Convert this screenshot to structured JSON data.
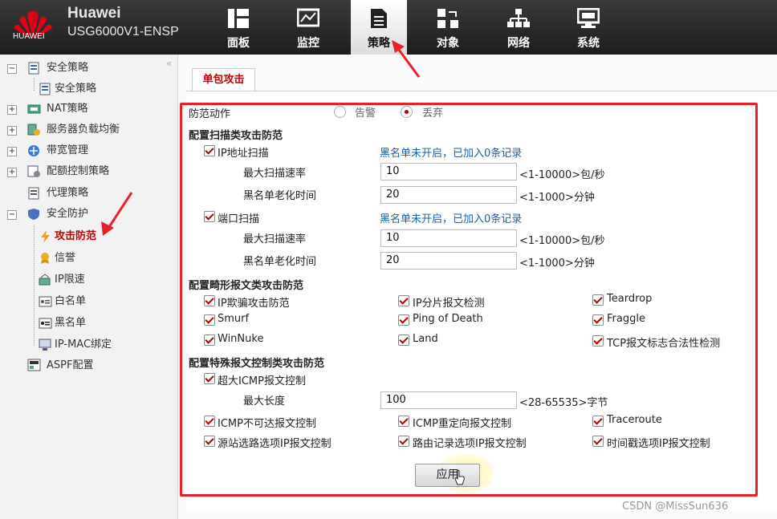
{
  "header": {
    "logo_text": "HUAWEI",
    "brand": "Huawei",
    "model": "USG6000V1-ENSP",
    "nav": [
      {
        "label": "面板",
        "icon": "dashboard-icon"
      },
      {
        "label": "监控",
        "icon": "monitor-icon"
      },
      {
        "label": "策略",
        "icon": "policy-icon",
        "active": true
      },
      {
        "label": "对象",
        "icon": "object-icon"
      },
      {
        "label": "网络",
        "icon": "network-icon"
      },
      {
        "label": "系统",
        "icon": "system-icon"
      }
    ]
  },
  "sidebar": {
    "items": [
      {
        "label": "安全策略",
        "expand": "-"
      },
      {
        "label": "安全策略"
      },
      {
        "label": "NAT策略",
        "expand": "+"
      },
      {
        "label": "服务器负载均衡",
        "expand": "+"
      },
      {
        "label": "带宽管理",
        "expand": "+"
      },
      {
        "label": "配额控制策略",
        "expand": "+"
      },
      {
        "label": "代理策略"
      },
      {
        "label": "安全防护",
        "expand": "-"
      },
      {
        "label": "攻击防范",
        "selected": true
      },
      {
        "label": "信誉"
      },
      {
        "label": "IP限速"
      },
      {
        "label": "白名单"
      },
      {
        "label": "黑名单"
      },
      {
        "label": "IP-MAC绑定"
      },
      {
        "label": "ASPF配置"
      }
    ]
  },
  "tab": {
    "label": "单包攻击"
  },
  "form": {
    "action_label": "防范动作",
    "action_options": [
      "告警",
      "丢弃"
    ],
    "action_selected": "丢弃",
    "scan_section": "配置扫描类攻击防范",
    "ip_scan": {
      "label": "IP地址扫描",
      "note": "黑名单未开启，已加入0条记录",
      "rate_label": "最大扫描速率",
      "rate_value": "10",
      "rate_range": "<1-10000>包/秒",
      "age_label": "黑名单老化时间",
      "age_value": "20",
      "age_range": "<1-1000>分钟"
    },
    "port_scan": {
      "label": "端口扫描",
      "note": "黑名单未开启，已加入0条记录",
      "rate_label": "最大扫描速率",
      "rate_value": "10",
      "rate_range": "<1-10000>包/秒",
      "age_label": "黑名单老化时间",
      "age_value": "20",
      "age_range": "<1-1000>分钟"
    },
    "malformed_section": "配置畸形报文类攻击防范",
    "malformed": [
      "IP欺骗攻击防范",
      "IP分片报文检测",
      "Teardrop",
      "Smurf",
      "Ping of Death",
      "Fraggle",
      "WinNuke",
      "Land",
      "TCP报文标志合法性检测"
    ],
    "special_section": "配置特殊报文控制类攻击防范",
    "large_icmp": {
      "label": "超大ICMP报文控制",
      "len_label": "最大长度",
      "len_value": "100",
      "len_range": "<28-65535>字节"
    },
    "special": [
      "ICMP不可达报文控制",
      "ICMP重定向报文控制",
      "Traceroute",
      "源站选路选项IP报文控制",
      "路由记录选项IP报文控制",
      "时间戳选项IP报文控制"
    ],
    "apply_label": "应用"
  },
  "colors": {
    "accent": "#c40000",
    "highlight_box": "#e8202a",
    "note": "#1a5fb4"
  },
  "watermark": "CSDN @MissSun636"
}
